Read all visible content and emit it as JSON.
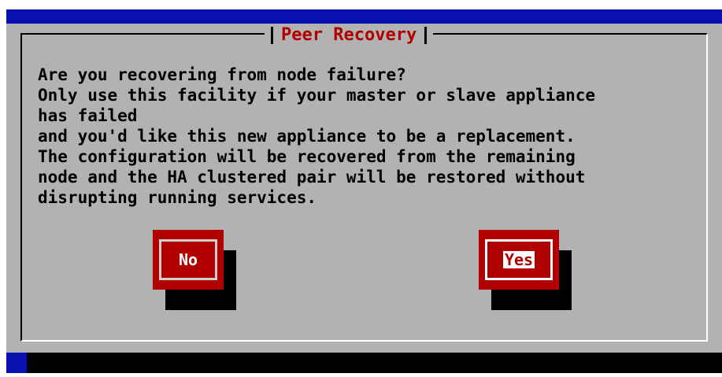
{
  "dialog": {
    "title": "Peer Recovery",
    "message": "Are you recovering from node failure?\nOnly use this facility if your master or slave appliance\nhas failed\nand you'd like this new appliance to be a replacement.\nThe configuration will be recovered from the remaining\nnode and the HA clustered pair will be restored without\ndisrupting running services.",
    "buttons": {
      "no_label": "No",
      "yes_label": "Yes"
    }
  },
  "colors": {
    "background": "#0a10b0",
    "dialog": "#b2b2b2",
    "title_text": "#b20000",
    "button": "#b00000"
  }
}
